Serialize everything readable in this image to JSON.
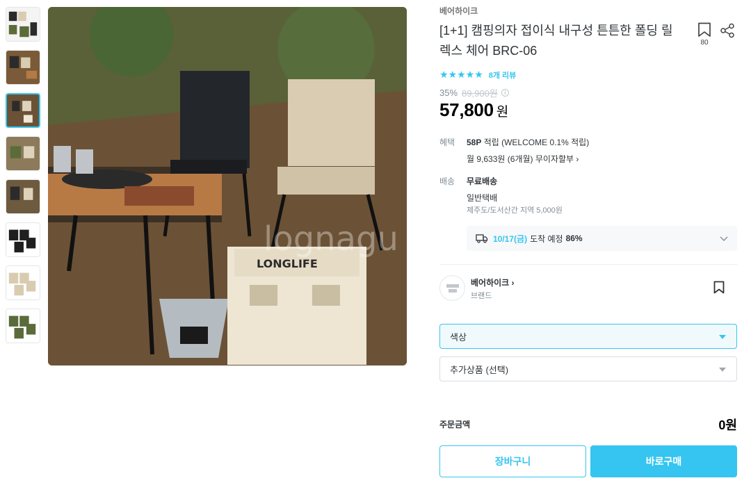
{
  "thumbnails": [
    {
      "name": "thumb-1",
      "variant": "group"
    },
    {
      "name": "thumb-2",
      "variant": "scene"
    },
    {
      "name": "thumb-3",
      "variant": "scene-active"
    },
    {
      "name": "thumb-4",
      "variant": "scene"
    },
    {
      "name": "thumb-5",
      "variant": "scene"
    },
    {
      "name": "thumb-6",
      "variant": "black-pair"
    },
    {
      "name": "thumb-7",
      "variant": "beige-pair"
    },
    {
      "name": "thumb-8",
      "variant": "green-pair"
    }
  ],
  "main_image": {
    "watermark": "lognagu"
  },
  "product": {
    "brand": "베어하이크",
    "title": "[1+1] 캠핑의자 접이식 내구성 튼튼한 폴딩 릴렉스 체어 BRC-06",
    "bookmark_count": "80",
    "stars": "★★★★★",
    "review_count": "8개 리뷰",
    "discount": "35%",
    "original_price": "89,900원",
    "price": "57,800",
    "currency": "원"
  },
  "benefit": {
    "label": "혜택",
    "points_bold": "58P",
    "points_rest": " 적립 (WELCOME 0.1% 적립)",
    "installment": "월 9,633원 (6개월) 무이자할부 ›"
  },
  "shipping": {
    "label": "배송",
    "type": "무료배송",
    "method": "일반택배",
    "extra": "제주도/도서산간 지역 5,000원",
    "eta_date": "10/17(금)",
    "eta_text": "도착 예정",
    "eta_pct": "86%"
  },
  "brand_card": {
    "name": "베어하이크 ›",
    "sub": "브랜드"
  },
  "options": {
    "color_placeholder": "색상",
    "extra_placeholder": "추가상품 (선택)"
  },
  "order": {
    "total_label": "주문금액",
    "total_value": "0원",
    "cart_button": "장바구니",
    "buy_button": "바로구매"
  },
  "colors": {
    "accent": "#35c5f0",
    "text": "#2f3438",
    "muted": "#828c94"
  }
}
